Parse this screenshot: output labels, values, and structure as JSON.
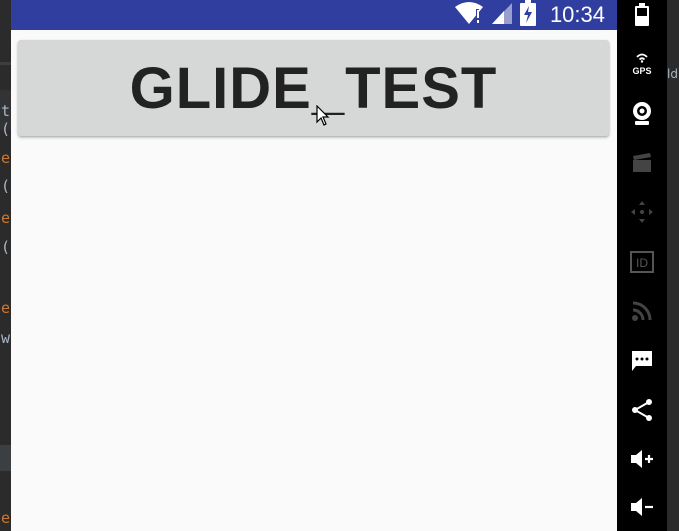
{
  "status_bar": {
    "time": "10:34",
    "background": "#303f9f"
  },
  "app": {
    "button_label": "GLIDE_TEST",
    "background": "#fafafa",
    "button_color": "#d6d7d7"
  },
  "emulator_toolbar": {
    "gps_label": "GPS",
    "id_label": "ID",
    "tools": [
      "battery-icon",
      "gps-icon",
      "camera-icon",
      "video-icon",
      "move-icon",
      "id-icon",
      "rss-icon",
      "message-icon",
      "share-icon",
      "volume-up-icon",
      "volume-down-icon"
    ]
  },
  "ide_background": {
    "left_code": [
      "t",
      "(",
      "e",
      "(",
      "e",
      "(",
      "e",
      "wi",
      "e"
    ],
    "right_code": "ld"
  }
}
